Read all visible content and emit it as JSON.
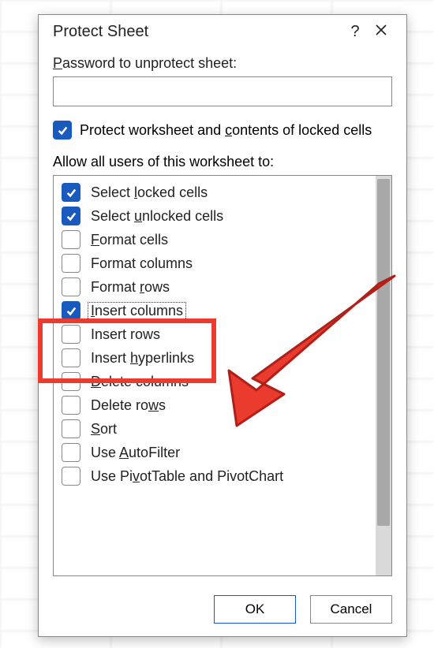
{
  "dialog": {
    "title": "Protect Sheet",
    "help_symbol": "?",
    "password_label_pre": "",
    "password_label_u": "P",
    "password_label_post": "assword to unprotect sheet:",
    "password_value": "",
    "protect_checkbox_checked": true,
    "protect_label_pre": "Protect worksheet and ",
    "protect_label_u": "c",
    "protect_label_post": "ontents of locked cells",
    "allow_label": "Allow all users of this worksheet to:",
    "buttons": {
      "ok": "OK",
      "cancel": "Cancel"
    }
  },
  "permissions": [
    {
      "checked": true,
      "focused": false,
      "pre": "Select ",
      "u": "l",
      "post": "ocked cells"
    },
    {
      "checked": true,
      "focused": false,
      "pre": "Select ",
      "u": "u",
      "post": "nlocked cells"
    },
    {
      "checked": false,
      "focused": false,
      "pre": "",
      "u": "F",
      "post": "ormat cells"
    },
    {
      "checked": false,
      "focused": false,
      "pre": "Format columns",
      "u": "",
      "post": ""
    },
    {
      "checked": false,
      "focused": false,
      "pre": "Format ",
      "u": "r",
      "post": "ows"
    },
    {
      "checked": true,
      "focused": true,
      "pre": "",
      "u": "I",
      "post": "nsert columns"
    },
    {
      "checked": false,
      "focused": false,
      "pre": "Insert rows",
      "u": "",
      "post": ""
    },
    {
      "checked": false,
      "focused": false,
      "pre": "Insert ",
      "u": "h",
      "post": "yperlinks"
    },
    {
      "checked": false,
      "focused": false,
      "pre": "",
      "u": "D",
      "post": "elete columns"
    },
    {
      "checked": false,
      "focused": false,
      "pre": "Delete ro",
      "u": "w",
      "post": "s"
    },
    {
      "checked": false,
      "focused": false,
      "pre": "",
      "u": "S",
      "post": "ort"
    },
    {
      "checked": false,
      "focused": false,
      "pre": "Use ",
      "u": "A",
      "post": "utoFilter"
    },
    {
      "checked": false,
      "focused": false,
      "pre": "Use Pi",
      "u": "v",
      "post": "otTable and PivotChart"
    }
  ]
}
